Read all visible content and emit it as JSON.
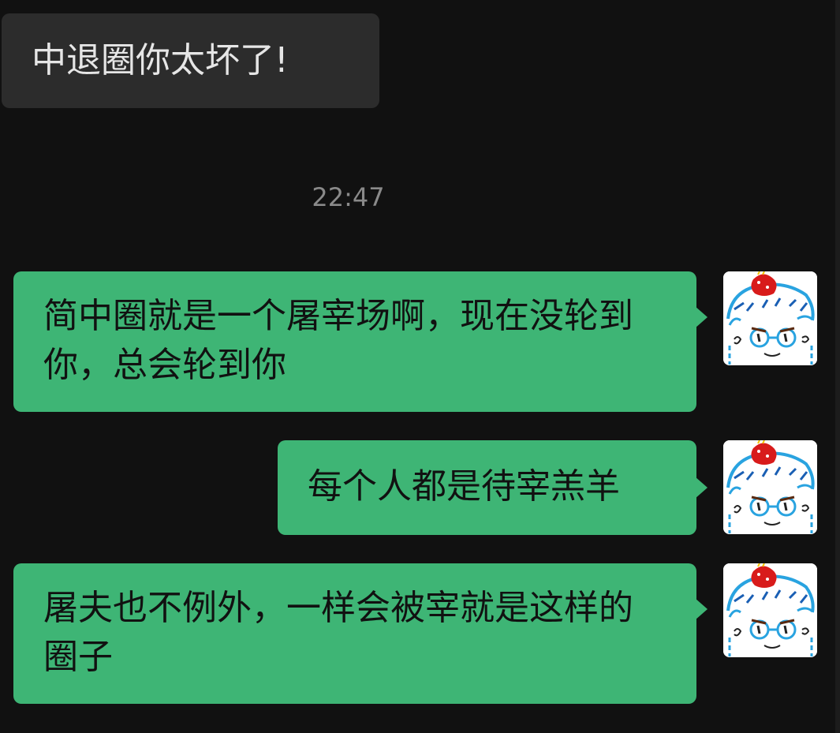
{
  "messages": [
    {
      "from": "other",
      "text": "中退圈你太坏了!"
    },
    {
      "from": "self",
      "text": "简中圈就是一个屠宰场啊，现在没轮到你，总会轮到你"
    },
    {
      "from": "self",
      "text": "每个人都是待宰羔羊"
    },
    {
      "from": "self",
      "text": "屠夫也不例外，一样会被宰就是这样的圈子"
    }
  ],
  "timestamp": "22:47",
  "avatar": {
    "icon": "cartoon-face-avatar-icon",
    "colors": {
      "hair": "#d81b1b",
      "glasses": "#29a3e0"
    }
  },
  "colors": {
    "background": "#111111",
    "incoming_bubble": "#2c2c2c",
    "outgoing_bubble": "#3eb575",
    "timestamp": "#8a8a8a"
  }
}
